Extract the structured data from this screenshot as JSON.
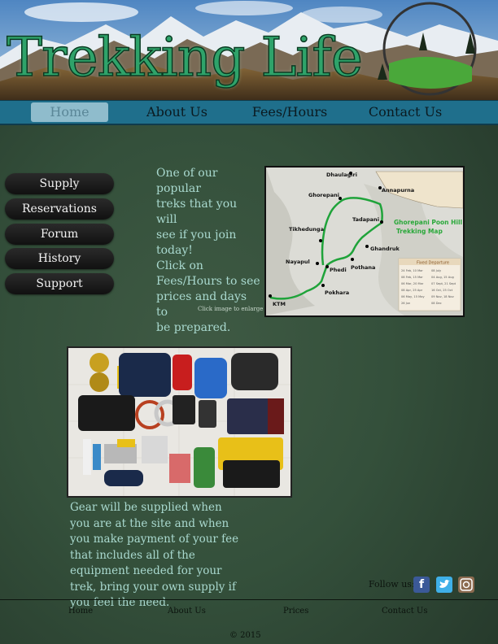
{
  "header": {
    "title": "Trekking Life"
  },
  "nav": {
    "items": [
      {
        "label": "Home",
        "active": true
      },
      {
        "label": "About Us",
        "active": false
      },
      {
        "label": "Fees/Hours",
        "active": false
      },
      {
        "label": "Contact Us",
        "active": false
      }
    ]
  },
  "sidebar": {
    "items": [
      {
        "label": "Supply"
      },
      {
        "label": "Reservations"
      },
      {
        "label": "Forum"
      },
      {
        "label": "History"
      },
      {
        "label": "Support"
      }
    ]
  },
  "main": {
    "intro_lines": [
      "One of our popular",
      "treks that you will",
      "see if you join",
      "today!",
      "Click on",
      "Fees/Hours to see",
      "prices and days to",
      "be prepared."
    ],
    "enlarge_caption": "Click image to enlarge",
    "map": {
      "title_line1": "Ghorepani Poon Hill",
      "title_line2": "Trekking Map",
      "places": [
        "Dhaulagiri",
        "Annapurna",
        "Ghorepani",
        "Tadapani",
        "Tikhedunga",
        "Ghandruk",
        "Nayapul",
        "Phedi",
        "Pothana",
        "Pokhara",
        "KTM"
      ],
      "departure_header": "Fixed Departure",
      "departure_left": [
        "24 Feb, 10 Mar",
        "08 Feb, 15 Mar",
        "06 Mar, 20 Mar",
        "08 Apr, 25 Apr",
        "06 May, 15 May",
        "26 Jun"
      ],
      "departure_right": [
        "08 July",
        "04 Aug, 15 Aug",
        "07 Sept, 21 Sept",
        "16 Oct, 25 Oct",
        "09 Nov, 18 Nov",
        "08 Dec"
      ]
    },
    "gear_text": "Gear will be supplied when you are at the site and when you make payment of your fee that includes all of the equipment needed for your trek, bring your own supply if you feel the need."
  },
  "follow": {
    "label": "Follow us:",
    "icons": [
      "facebook-icon",
      "twitter-icon",
      "instagram-icon"
    ],
    "colors": {
      "facebook": "#3b5998",
      "twitter": "#3fb0e8",
      "instagram": "#8b6a4f"
    }
  },
  "footer": {
    "links": [
      "Home",
      "About Us",
      "Prices",
      "Contact Us"
    ],
    "copyright": "© 2015"
  },
  "colors": {
    "background": "#34503b",
    "nav": "#1f6f8c",
    "title": "#2fa36a",
    "body_text": "#a9d9cf",
    "route": "#1fa33a"
  }
}
